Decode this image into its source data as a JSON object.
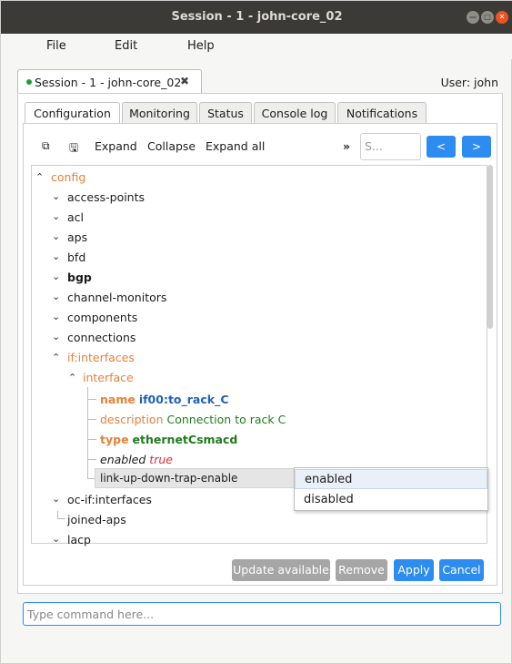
{
  "window": {
    "title": "Session - 1 - john-core_02"
  },
  "menu": [
    "File",
    "Edit",
    "Help"
  ],
  "session_tab": {
    "label": "Session - 1 - john-core_02",
    "close": "✖"
  },
  "user_label": "User: john",
  "tabs": [
    "Configuration",
    "Monitoring",
    "Status",
    "Console log",
    "Notifications"
  ],
  "toolbar": {
    "expand": "Expand",
    "collapse": "Collapse",
    "expand_all": "Expand all",
    "more": "»",
    "search_placeholder": "S...",
    "prev": "<",
    "next": ">"
  },
  "tree": {
    "root": "config",
    "items": [
      "access-points",
      "acl",
      "aps",
      "bfd",
      "bgp",
      "channel-monitors",
      "components",
      "connections"
    ],
    "interfaces": "if:interfaces",
    "interface": "interface",
    "leaves": [
      {
        "key": "name",
        "value": "if00:to_rack_C"
      },
      {
        "key": "description",
        "value": "Connection to rack C"
      },
      {
        "key": "type",
        "value": "ethernetCsmacd"
      },
      {
        "key": "enabled",
        "value": "true"
      }
    ],
    "editing": "link-up-down-trap-enable",
    "after": [
      "oc-if:interfaces",
      "joined-aps",
      "lacp"
    ]
  },
  "dropdown": {
    "options": [
      "enabled",
      "disabled"
    ]
  },
  "buttons": {
    "update": "Update available",
    "remove": "Remove",
    "apply": "Apply",
    "cancel": "Cancel"
  },
  "command_placeholder": "Type command here...",
  "colors": {
    "accent": "#2d8cf0",
    "node_open": "#e8803a",
    "value_blue": "#2063b5",
    "value_green": "#1f7b1f",
    "value_red": "#d0343c",
    "disabled_btn": "#a6a6a6"
  }
}
